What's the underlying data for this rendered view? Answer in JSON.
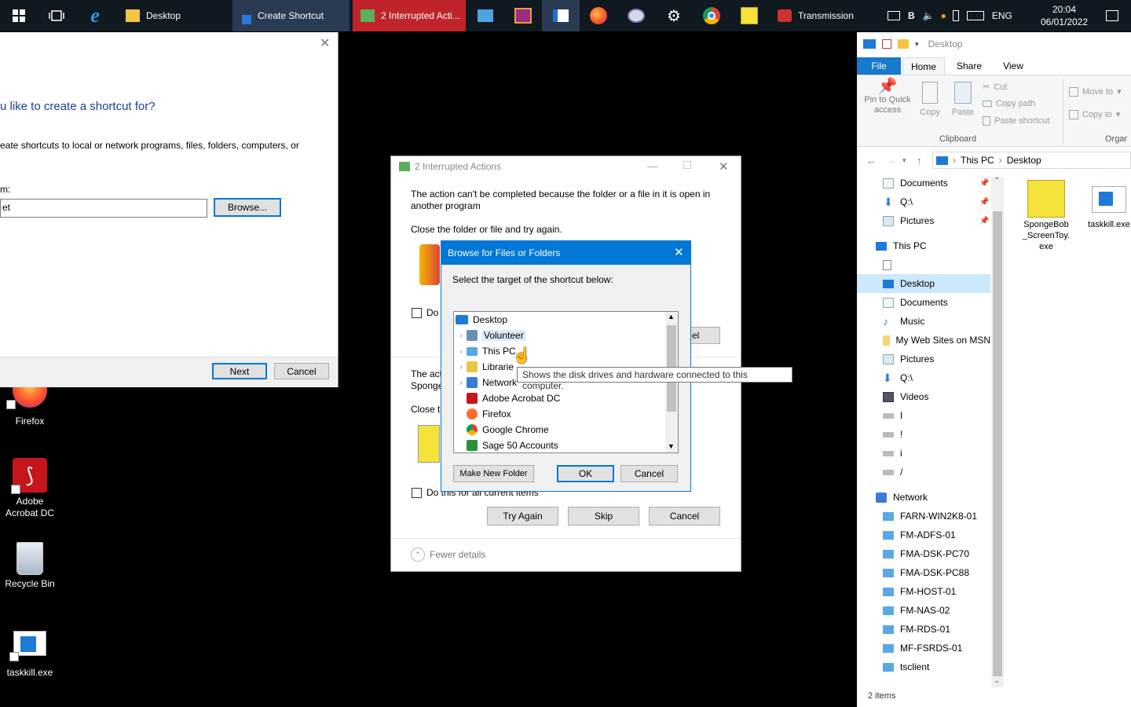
{
  "taskbar": {
    "desktop_label": "Desktop",
    "create_shortcut_label": "Create Shortcut",
    "interrupted_label": "2 Interrupted Acti...",
    "transmission_label": "Transmission",
    "lang": "ENG",
    "tray_b": "B",
    "time": "20:04",
    "date": "06/01/2022"
  },
  "wizard": {
    "heading": "u like to create a shortcut for?",
    "description": "eate shortcuts to local or network programs, files, folders, computers, or",
    "field_label": "m:",
    "location_value": "et",
    "browse_label": "Browse...",
    "next_label": "Next",
    "cancel_label": "Cancel"
  },
  "desktop_icons": [
    {
      "label": "Firefox"
    },
    {
      "label": "Adobe Acrobat DC"
    },
    {
      "label": "Recycle Bin"
    },
    {
      "label": "taskkill.exe"
    }
  ],
  "interrupted": {
    "title": "2 Interrupted Actions",
    "message": "The action can't be completed because the folder or a file in it is open in another program",
    "close_msg": "Close the folder or file and try again.",
    "do_partial": "Do",
    "second_line1": "The act",
    "second_line2": "Sponge",
    "close_partial": "Close t",
    "cancel_partial": "el",
    "do_all_label": "Do this for all current items",
    "try_again_label": "Try Again",
    "skip_label": "Skip",
    "cancel_label": "Cancel",
    "fewer_details": "Fewer details"
  },
  "browse": {
    "title": "Browse for Files or Folders",
    "instruction": "Select the target of the shortcut below:",
    "tree": [
      {
        "label": "Desktop"
      },
      {
        "label": "Volunteer"
      },
      {
        "label": "This PC"
      },
      {
        "label": "Librarie"
      },
      {
        "label": "Network"
      },
      {
        "label": "Adobe Acrobat DC"
      },
      {
        "label": "Firefox"
      },
      {
        "label": "Google Chrome"
      },
      {
        "label": "Sage 50 Accounts"
      }
    ],
    "tooltip": "Shows the disk drives and hardware connected to this computer.",
    "make_folder_label": "Make New Folder",
    "ok_label": "OK",
    "cancel_label": "Cancel"
  },
  "explorer": {
    "title": "Desktop",
    "tabs": [
      "File",
      "Home",
      "Share",
      "View"
    ],
    "ribbon": {
      "pin": "Pin to Quick access",
      "copy": "Copy",
      "paste": "Paste",
      "cut": "Cut",
      "copy_path": "Copy path",
      "paste_shortcut": "Paste shortcut",
      "clipboard": "Clipboard",
      "move_to": "Move to",
      "copy_to": "Copy to",
      "organise": "Orgar"
    },
    "breadcrumb": [
      "This PC",
      "Desktop"
    ],
    "nav": [
      {
        "label": "Documents"
      },
      {
        "label": "Q:\\"
      },
      {
        "label": "Pictures"
      },
      {
        "label": "This PC"
      },
      {
        "label": ""
      },
      {
        "label": "Desktop"
      },
      {
        "label": "Documents"
      },
      {
        "label": "Music"
      },
      {
        "label": "My Web Sites on MSN"
      },
      {
        "label": "Pictures"
      },
      {
        "label": "Q:\\"
      },
      {
        "label": "Videos"
      },
      {
        "label": "I"
      },
      {
        "label": "!"
      },
      {
        "label": "i"
      },
      {
        "label": "/"
      },
      {
        "label": "Network"
      },
      {
        "label": "FARN-WIN2K8-01"
      },
      {
        "label": "FM-ADFS-01"
      },
      {
        "label": "FMA-DSK-PC70"
      },
      {
        "label": "FMA-DSK-PC88"
      },
      {
        "label": "FM-HOST-01"
      },
      {
        "label": "FM-NAS-02"
      },
      {
        "label": "FM-RDS-01"
      },
      {
        "label": "MF-FSRDS-01"
      },
      {
        "label": "tsclient"
      }
    ],
    "files": [
      {
        "label": "SpongeBob _ScreenToy. exe"
      },
      {
        "label": "taskkill.exe"
      }
    ],
    "status": "2 items"
  }
}
